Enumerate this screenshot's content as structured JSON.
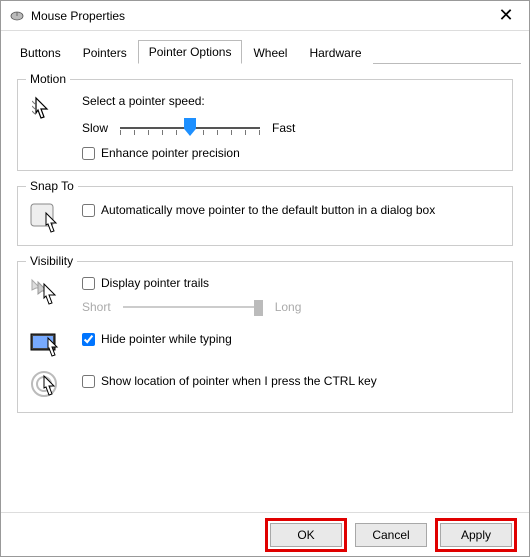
{
  "title": "Mouse Properties",
  "tabs": {
    "buttons": "Buttons",
    "pointers": "Pointers",
    "pointer_options": "Pointer Options",
    "wheel": "Wheel",
    "hardware": "Hardware"
  },
  "motion": {
    "legend": "Motion",
    "label": "Select a pointer speed:",
    "slow": "Slow",
    "fast": "Fast",
    "slider": {
      "min": 0,
      "max": 10,
      "value": 5
    },
    "enhance": {
      "checked": false,
      "label": "Enhance pointer precision"
    }
  },
  "snap_to": {
    "legend": "Snap To",
    "auto": {
      "checked": false,
      "label": "Automatically move pointer to the default button in a dialog box"
    }
  },
  "visibility": {
    "legend": "Visibility",
    "trails": {
      "checked": false,
      "label": "Display pointer trails",
      "short": "Short",
      "long": "Long"
    },
    "hide": {
      "checked": true,
      "label": "Hide pointer while typing"
    },
    "ctrl": {
      "checked": false,
      "label": "Show location of pointer when I press the CTRL key"
    }
  },
  "footer": {
    "ok": "OK",
    "cancel": "Cancel",
    "apply": "Apply"
  }
}
